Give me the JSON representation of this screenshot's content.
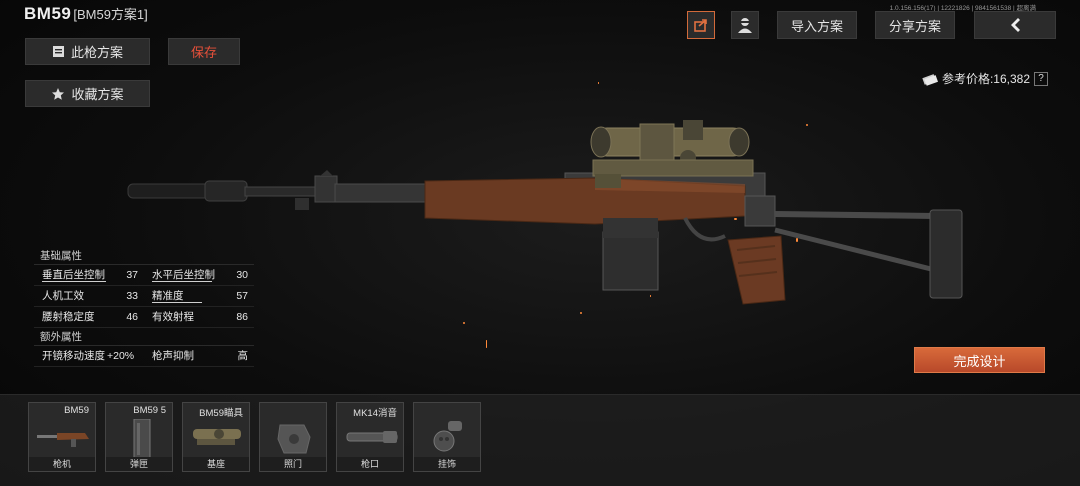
{
  "header": {
    "gun_name": "BM59",
    "plan_name": "[BM59方案1]",
    "gun_plan_label": "此枪方案",
    "save_label": "保存",
    "favorite_label": "收藏方案",
    "version_text": "1.0.156.156(17) | 12221826 | 9841561538 | 超离满",
    "import_label": "导入方案",
    "share_label": "分享方案",
    "price_label": "参考价格:16,382",
    "help_label": "?"
  },
  "stats": {
    "basic_title": "基础属性",
    "rows": [
      {
        "a_label": "垂直后坐控制",
        "a_value": "37",
        "b_label": "水平后坐控制",
        "b_value": "30"
      },
      {
        "a_label": "人机工效",
        "a_value": "33",
        "b_label": "精准度",
        "b_value": "57"
      },
      {
        "a_label": "腰射稳定度",
        "a_value": "46",
        "b_label": "有效射程",
        "b_value": "86"
      }
    ],
    "extra_title": "额外属性",
    "extra": {
      "a_label": "开镜移动速度",
      "a_value": "+20%",
      "b_label": "枪声抑制",
      "b_value": "高"
    }
  },
  "finish_label": "完成设计",
  "parts": [
    {
      "name": "BM59",
      "category": "枪机",
      "icon": "rifle-body-icon"
    },
    {
      "name": "BM59 5",
      "category": "弹匣",
      "icon": "magazine-icon"
    },
    {
      "name": "BM59瞄具",
      "category": "基座",
      "icon": "sight-mount-icon"
    },
    {
      "name": "",
      "category": "照门",
      "icon": "rear-sight-icon"
    },
    {
      "name": "MK14消音",
      "category": "枪口",
      "icon": "suppressor-icon"
    },
    {
      "name": "",
      "category": "挂饰",
      "icon": "charm-icon"
    }
  ],
  "colors": {
    "accent": "#c8552e",
    "save_text": "#e8503a"
  }
}
